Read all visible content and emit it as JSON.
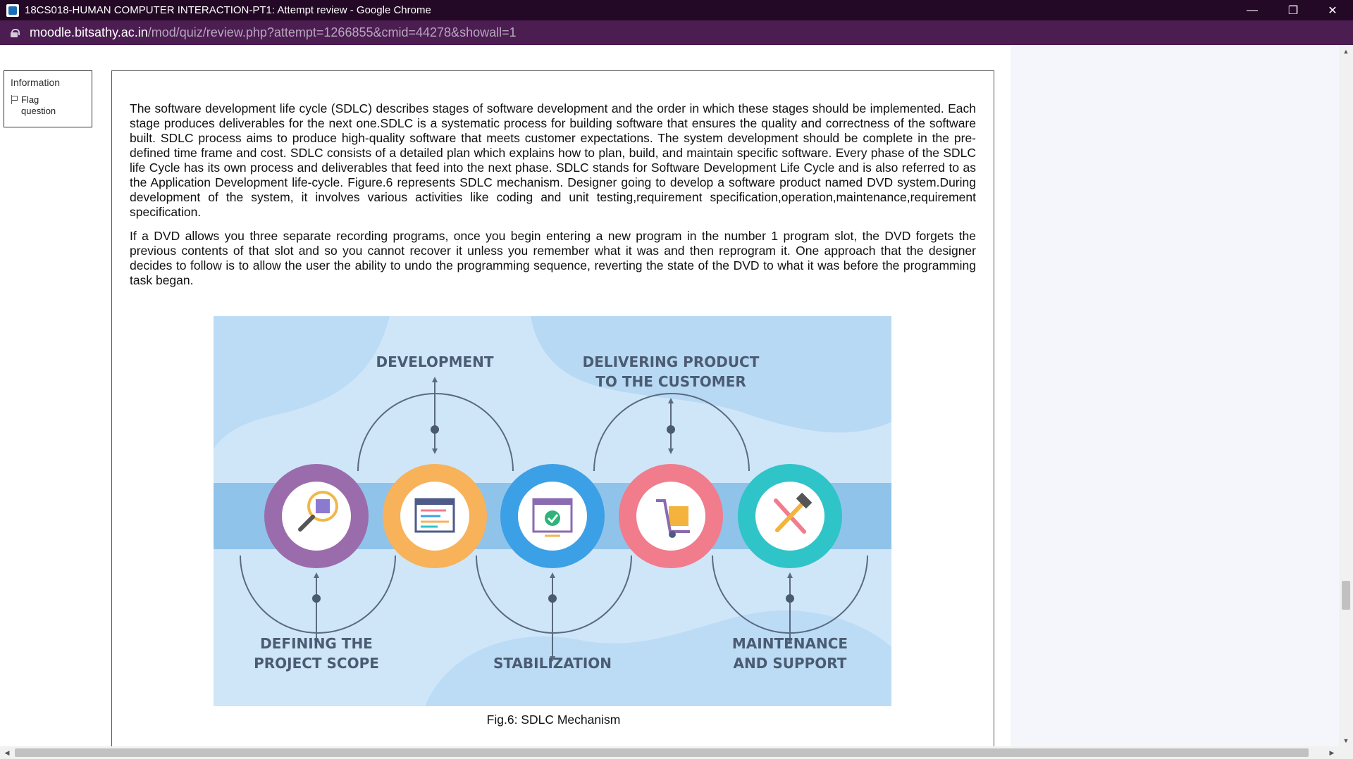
{
  "window": {
    "title": "18CS018-HUMAN COMPUTER INTERACTION-PT1: Attempt review - Google Chrome",
    "controls": {
      "minimize": "—",
      "restore": "❐",
      "close": "✕"
    }
  },
  "address_bar": {
    "host": "moodle.bitsathy.ac.in",
    "path": "/mod/quiz/review.php?attempt=1266855&cmid=44278&showall=1"
  },
  "info_block": {
    "label": "Information",
    "flag_label": "Flag question"
  },
  "question": {
    "paragraph_1": "The software development life cycle (SDLC) describes stages of software development and the order in which these stages should be implemented. Each stage produces deliverables for the next one.SDLC is a systematic process for building software that ensures the quality and correctness of the software built. SDLC process aims to produce high-quality software that meets customer expectations. The system development should be complete in the pre-defined time frame and cost. SDLC consists of a detailed plan which explains how to plan, build, and maintain specific software. Every phase of the SDLC life Cycle has its own process and deliverables that feed into the next phase. SDLC stands for Software Development Life Cycle and is also referred to as the Application Development life-cycle. Figure.6 represents SDLC mechanism. Designer going to develop a software product named DVD system.During development of the system, it involves various activities like coding and unit testing,requirement specification,operation,maintenance,requirement specification.",
    "paragraph_2": "If a DVD allows you three separate recording programs, once you begin entering a new program in the number 1 program slot, the DVD forgets the previous contents of that slot and so you cannot recover it unless you remember what it was and then reprogram it. One approach that the designer decides to follow is to allow the user the ability to undo the programming sequence, reverting the state of the DVD to what it was before the programming task began.",
    "figure_caption": "Fig.6: SDLC Mechanism"
  },
  "figure": {
    "stages": [
      {
        "label_1": "DEFINING THE",
        "label_2": "PROJECT SCOPE",
        "color": "#9b6cab",
        "icon": "magnifier-grid-icon"
      },
      {
        "label_1": "DEVELOPMENT",
        "label_2": "",
        "color": "#f7b25a",
        "icon": "code-window-icon"
      },
      {
        "label_1": "STABILIZATION",
        "label_2": "",
        "color": "#3ca0e6",
        "icon": "check-window-icon"
      },
      {
        "label_1": "DELIVERING PRODUCT",
        "label_2": "TO THE CUSTOMER",
        "color": "#f07c8c",
        "icon": "hand-truck-icon"
      },
      {
        "label_1": "MAINTENANCE",
        "label_2": "AND SUPPORT",
        "color": "#2fc4c8",
        "icon": "hammer-screwdriver-icon"
      }
    ],
    "background_color": "#cfe6f9",
    "band_color": "#8fc3ea",
    "label_color": "#4b5b72"
  }
}
